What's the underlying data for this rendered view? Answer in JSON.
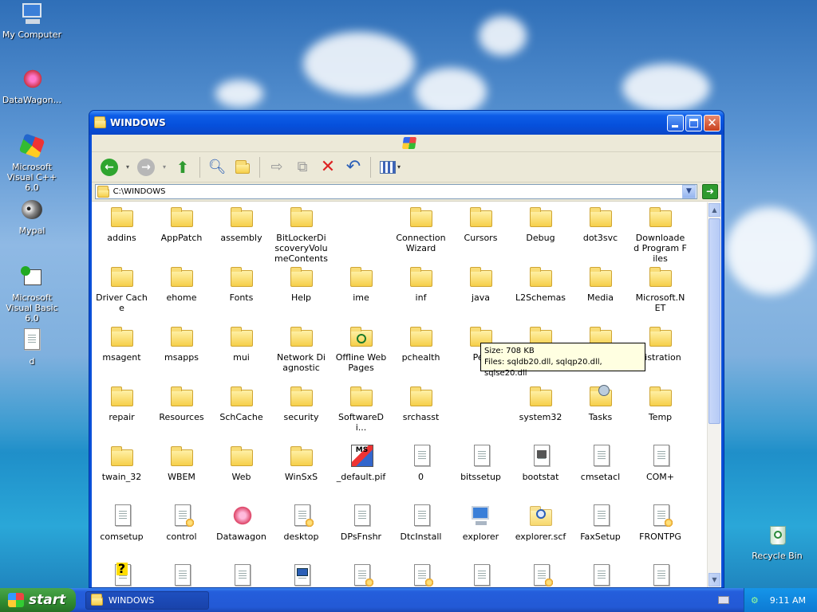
{
  "desktop": {
    "icons": [
      {
        "label": "My Computer"
      },
      {
        "label": "DataWagon..."
      },
      {
        "label": "Microsoft Visual C++ 6.0"
      },
      {
        "label": "Mypal"
      },
      {
        "label": "Microsoft Visual Basic 6.0"
      },
      {
        "label": "d"
      },
      {
        "label": "Recycle Bin"
      }
    ]
  },
  "window": {
    "title": "WINDOWS",
    "address": "C:\\WINDOWS",
    "items": [
      {
        "label": "addins",
        "icon": "folder-icon"
      },
      {
        "label": "AppPatch",
        "icon": "folder-icon"
      },
      {
        "label": "assembly",
        "icon": "folder-icon"
      },
      {
        "label": "BitLockerDiscoveryVolumeContents",
        "icon": "folder-icon"
      },
      {
        "label": "",
        "icon": "none"
      },
      {
        "label": "Connection Wizard",
        "icon": "folder-icon"
      },
      {
        "label": "Cursors",
        "icon": "folder-icon"
      },
      {
        "label": "Debug",
        "icon": "folder-icon"
      },
      {
        "label": "dot3svc",
        "icon": "folder-icon"
      },
      {
        "label": "Downloaded Program Files",
        "icon": "special-folder-icon"
      },
      {
        "label": "Driver Cache",
        "icon": "folder-icon"
      },
      {
        "label": "ehome",
        "icon": "folder-icon"
      },
      {
        "label": "Fonts",
        "icon": "folder-icon"
      },
      {
        "label": "Help",
        "icon": "folder-icon"
      },
      {
        "label": "ime",
        "icon": "folder-icon"
      },
      {
        "label": "inf",
        "icon": "folder-icon"
      },
      {
        "label": "java",
        "icon": "folder-icon"
      },
      {
        "label": "L2Schemas",
        "icon": "folder-icon"
      },
      {
        "label": "Media",
        "icon": "folder-icon"
      },
      {
        "label": "Microsoft.NET",
        "icon": "folder-icon"
      },
      {
        "label": "msagent",
        "icon": "folder-icon"
      },
      {
        "label": "msapps",
        "icon": "folder-icon"
      },
      {
        "label": "mui",
        "icon": "folder-icon"
      },
      {
        "label": "Network Diagnostic",
        "icon": "folder-icon"
      },
      {
        "label": "Offline Web Pages",
        "icon": "offline-folder-icon"
      },
      {
        "label": "pchealth",
        "icon": "folder-icon"
      },
      {
        "label": "Pee",
        "icon": "folder-icon"
      },
      {
        "label": "",
        "icon": "folder-icon"
      },
      {
        "label": "",
        "icon": "folder-icon"
      },
      {
        "label": "gistration",
        "icon": "folder-icon"
      },
      {
        "label": "repair",
        "icon": "folder-icon"
      },
      {
        "label": "Resources",
        "icon": "folder-icon"
      },
      {
        "label": "SchCache",
        "icon": "folder-icon"
      },
      {
        "label": "security",
        "icon": "folder-icon"
      },
      {
        "label": "SoftwareDi...",
        "icon": "folder-icon"
      },
      {
        "label": "srchasst",
        "icon": "folder-icon"
      },
      {
        "label": "",
        "icon": "none"
      },
      {
        "label": "system32",
        "icon": "folder-icon"
      },
      {
        "label": "Tasks",
        "icon": "tasks-folder-icon"
      },
      {
        "label": "Temp",
        "icon": "folder-icon"
      },
      {
        "label": "twain_32",
        "icon": "folder-icon"
      },
      {
        "label": "WBEM",
        "icon": "folder-icon"
      },
      {
        "label": "Web",
        "icon": "folder-icon"
      },
      {
        "label": "WinSxS",
        "icon": "folder-icon"
      },
      {
        "label": "_default.pif",
        "icon": "msdos-icon"
      },
      {
        "label": "0",
        "icon": "text-file-icon"
      },
      {
        "label": "bitssetup",
        "icon": "text-file-icon"
      },
      {
        "label": "bootstat",
        "icon": "dat-file-icon"
      },
      {
        "label": "cmsetacl",
        "icon": "text-file-icon"
      },
      {
        "label": "COM+",
        "icon": "text-file-icon"
      },
      {
        "label": "comsetup",
        "icon": "text-file-icon"
      },
      {
        "label": "control",
        "icon": "config-file-icon"
      },
      {
        "label": "Datawagon",
        "icon": "datawagon-icon"
      },
      {
        "label": "desktop",
        "icon": "config-file-icon"
      },
      {
        "label": "DPsFnshr",
        "icon": "text-file-icon"
      },
      {
        "label": "DtcInstall",
        "icon": "text-file-icon"
      },
      {
        "label": "explorer",
        "icon": "explorer-icon"
      },
      {
        "label": "explorer.scf",
        "icon": "search-file-icon"
      },
      {
        "label": "FaxSetup",
        "icon": "text-file-icon"
      },
      {
        "label": "FRONTPG",
        "icon": "config-file-icon"
      },
      {
        "label": "",
        "icon": "help-file-icon"
      },
      {
        "label": "",
        "icon": "text-file-icon"
      },
      {
        "label": "",
        "icon": "text-file-icon"
      },
      {
        "label": "",
        "icon": "window-file-icon"
      },
      {
        "label": "",
        "icon": "config-file-icon"
      },
      {
        "label": "",
        "icon": "config-file-icon"
      },
      {
        "label": "",
        "icon": "text-file-icon"
      },
      {
        "label": "",
        "icon": "config-file-icon"
      },
      {
        "label": "",
        "icon": "text-file-icon"
      },
      {
        "label": "",
        "icon": "text-file-icon"
      }
    ],
    "tooltip": {
      "size": "Size: 708 KB",
      "files": "Files: sqldb20.dll, sqlqp20.dll, sqlse20.dll"
    }
  },
  "taskbar": {
    "start_label": "start",
    "task_label": "WINDOWS",
    "clock": "9:11 AM"
  },
  "colors": {
    "titlebar": "#0a5ae0",
    "taskbar": "#245edc",
    "start": "#2f8a2f",
    "tooltip_bg": "#ffffe1"
  }
}
